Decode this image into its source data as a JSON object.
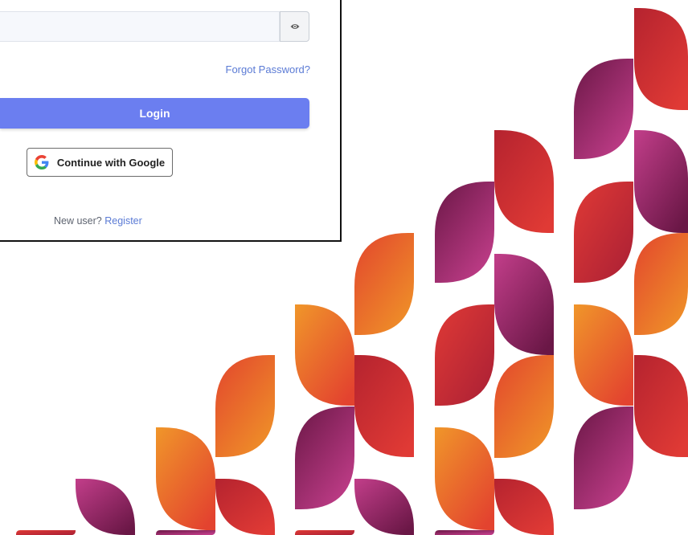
{
  "login": {
    "password": {
      "value": "",
      "placeholder": ""
    },
    "toggle_icon": "eye-icon",
    "forgot_label": "Forgot Password?",
    "login_label": "Login",
    "google_label": "Continue with Google",
    "google_icon": "google-icon",
    "new_user_text": "New user?",
    "register_label": "Register"
  },
  "colors": {
    "primary": "#6b7ef0",
    "link": "#5b7bd5",
    "card_border": "#111111",
    "leaf_red": "#d8303a",
    "leaf_orange": "#e96a2a",
    "leaf_magenta": "#a02b6e",
    "leaf_purple": "#6d1a4a"
  }
}
